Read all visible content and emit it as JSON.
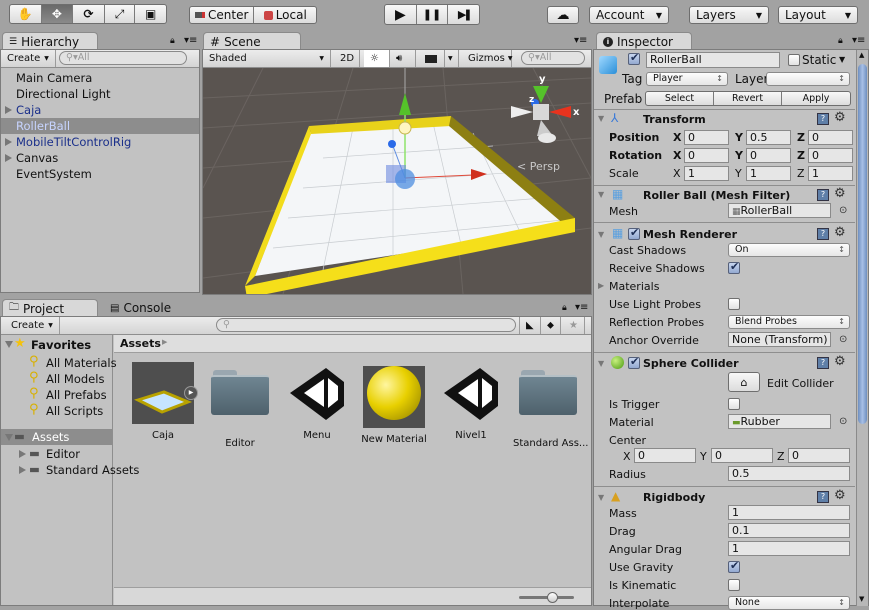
{
  "toolbar": {
    "tools": [
      {
        "name": "hand-tool",
        "glyph": "✋",
        "active": false
      },
      {
        "name": "move-tool",
        "glyph": "✥",
        "active": true
      },
      {
        "name": "rotate-tool",
        "glyph": "⟳",
        "active": false
      },
      {
        "name": "scale-tool",
        "glyph": "⤢",
        "active": false
      },
      {
        "name": "rect-tool",
        "glyph": "▣",
        "active": false
      }
    ],
    "pivot_center": "Center",
    "pivot_local": "Local",
    "play": "▶",
    "pause": "❚❚",
    "step": "▶❚",
    "cloud": "☁",
    "account": "Account",
    "layers": "Layers",
    "layout": "Layout"
  },
  "hierarchy": {
    "tab": "Hierarchy",
    "create": "Create",
    "search_placeholder": "All",
    "items": [
      {
        "label": "Main Camera",
        "expandable": false,
        "prefab": false,
        "selected": false
      },
      {
        "label": "Directional Light",
        "expandable": false,
        "prefab": false,
        "selected": false
      },
      {
        "label": "Caja",
        "expandable": true,
        "prefab": true,
        "selected": false
      },
      {
        "label": "RollerBall",
        "expandable": false,
        "prefab": true,
        "selected": true
      },
      {
        "label": "MobileTiltControlRig",
        "expandable": true,
        "prefab": true,
        "selected": false
      },
      {
        "label": "Canvas",
        "expandable": true,
        "prefab": false,
        "selected": false
      },
      {
        "label": "EventSystem",
        "expandable": false,
        "prefab": false,
        "selected": false
      }
    ]
  },
  "scene": {
    "tab": "Scene",
    "shading": "Shaded",
    "mode_2d": "2D",
    "gizmos": "Gizmos",
    "search_placeholder": "All",
    "persp_label": "Persp",
    "axis_x": "x",
    "axis_y": "y",
    "axis_z": "z"
  },
  "project": {
    "tab": "Project",
    "console_tab": "Console",
    "create": "Create",
    "favorites_label": "Favorites",
    "favorites": [
      "All Materials",
      "All Models",
      "All Prefabs",
      "All Scripts"
    ],
    "assets_label": "Assets",
    "asset_folders": [
      "Editor",
      "Standard Assets"
    ],
    "breadcrumb": "Assets",
    "assets": [
      {
        "name": "Caja",
        "type": "prefab"
      },
      {
        "name": "Editor",
        "type": "folder"
      },
      {
        "name": "Menu",
        "type": "scene"
      },
      {
        "name": "New Material",
        "type": "material"
      },
      {
        "name": "Nivel1",
        "type": "scene"
      },
      {
        "name": "Standard Ass...",
        "type": "folder"
      }
    ],
    "icon_size": 0.6
  },
  "inspector": {
    "tab": "Inspector",
    "object_name": "RollerBall",
    "active": true,
    "static_label": "Static",
    "static": false,
    "tag_label": "Tag",
    "tag": "Player",
    "layer_label": "Layer",
    "layer": "",
    "prefab_label": "Prefab",
    "prefab_select": "Select",
    "prefab_revert": "Revert",
    "prefab_apply": "Apply",
    "transform": {
      "title": "Transform",
      "position_label": "Position",
      "rotation_label": "Rotation",
      "scale_label": "Scale",
      "position": {
        "x": "0",
        "y": "0.5",
        "z": "0"
      },
      "rotation": {
        "x": "0",
        "y": "0",
        "z": "0"
      },
      "scale": {
        "x": "1",
        "y": "1",
        "z": "1"
      }
    },
    "mesh_filter": {
      "title": "Roller Ball (Mesh Filter)",
      "mesh_label": "Mesh",
      "mesh": "RollerBall"
    },
    "mesh_renderer": {
      "title": "Mesh Renderer",
      "enabled": true,
      "cast_shadows_label": "Cast Shadows",
      "cast_shadows": "On",
      "receive_shadows_label": "Receive Shadows",
      "receive_shadows": true,
      "materials_label": "Materials",
      "use_light_probes_label": "Use Light Probes",
      "use_light_probes": false,
      "reflection_probes_label": "Reflection Probes",
      "reflection_probes": "Blend Probes",
      "anchor_override_label": "Anchor Override",
      "anchor_override": "None (Transform)"
    },
    "sphere_collider": {
      "title": "Sphere Collider",
      "enabled": true,
      "edit_collider": "Edit Collider",
      "is_trigger_label": "Is Trigger",
      "is_trigger": false,
      "material_label": "Material",
      "material": "Rubber",
      "center_label": "Center",
      "center": {
        "x": "0",
        "y": "0",
        "z": "0"
      },
      "radius_label": "Radius",
      "radius": "0.5"
    },
    "rigidbody": {
      "title": "Rigidbody",
      "mass_label": "Mass",
      "mass": "1",
      "drag_label": "Drag",
      "drag": "0.1",
      "angular_drag_label": "Angular Drag",
      "angular_drag": "1",
      "use_gravity_label": "Use Gravity",
      "use_gravity": true,
      "is_kinematic_label": "Is Kinematic",
      "is_kinematic": false,
      "interpolate_label": "Interpolate",
      "interpolate": "None"
    },
    "axis_labels": {
      "x": "X",
      "y": "Y",
      "z": "Z"
    }
  }
}
